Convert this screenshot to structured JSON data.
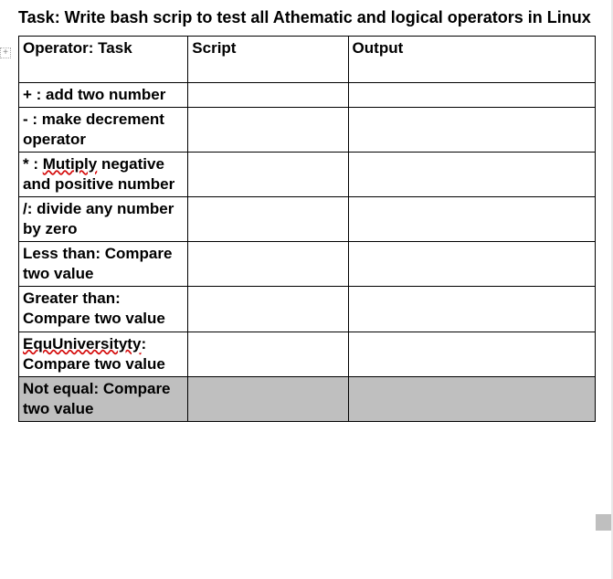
{
  "title": "Task: Write bash scrip to test all Athematic and logical operators in Linux",
  "headers": {
    "col1": "Operator: Task",
    "col2": "Script",
    "col3": "Output"
  },
  "rows": [
    {
      "task_pre": "+ : add two number",
      "spell": "",
      "task_post": "",
      "script": "",
      "output": "",
      "highlighted": false
    },
    {
      "task_pre": "- : make decrement operator",
      "spell": "",
      "task_post": "",
      "script": "",
      "output": "",
      "highlighted": false
    },
    {
      "task_pre": "* : ",
      "spell": "Mutiply",
      "task_post": " negative and positive number",
      "script": "",
      "output": "",
      "highlighted": false
    },
    {
      "task_pre": "/:  divide any number by zero",
      "spell": "",
      "task_post": "",
      "script": "",
      "output": "",
      "highlighted": false
    },
    {
      "task_pre": "Less than: Compare two value",
      "spell": "",
      "task_post": "",
      "script": "",
      "output": "",
      "highlighted": false
    },
    {
      "task_pre": "Greater than: Compare two value",
      "spell": "",
      "task_post": "",
      "script": "",
      "output": "",
      "highlighted": false
    },
    {
      "task_pre": "",
      "spell": "EquUniversityty",
      "task_post": ": Compare two value",
      "script": "",
      "output": "",
      "highlighted": false
    },
    {
      "task_pre": "Not equal: Compare two value",
      "spell": "",
      "task_post": "",
      "script": "",
      "output": "",
      "highlighted": true
    }
  ]
}
